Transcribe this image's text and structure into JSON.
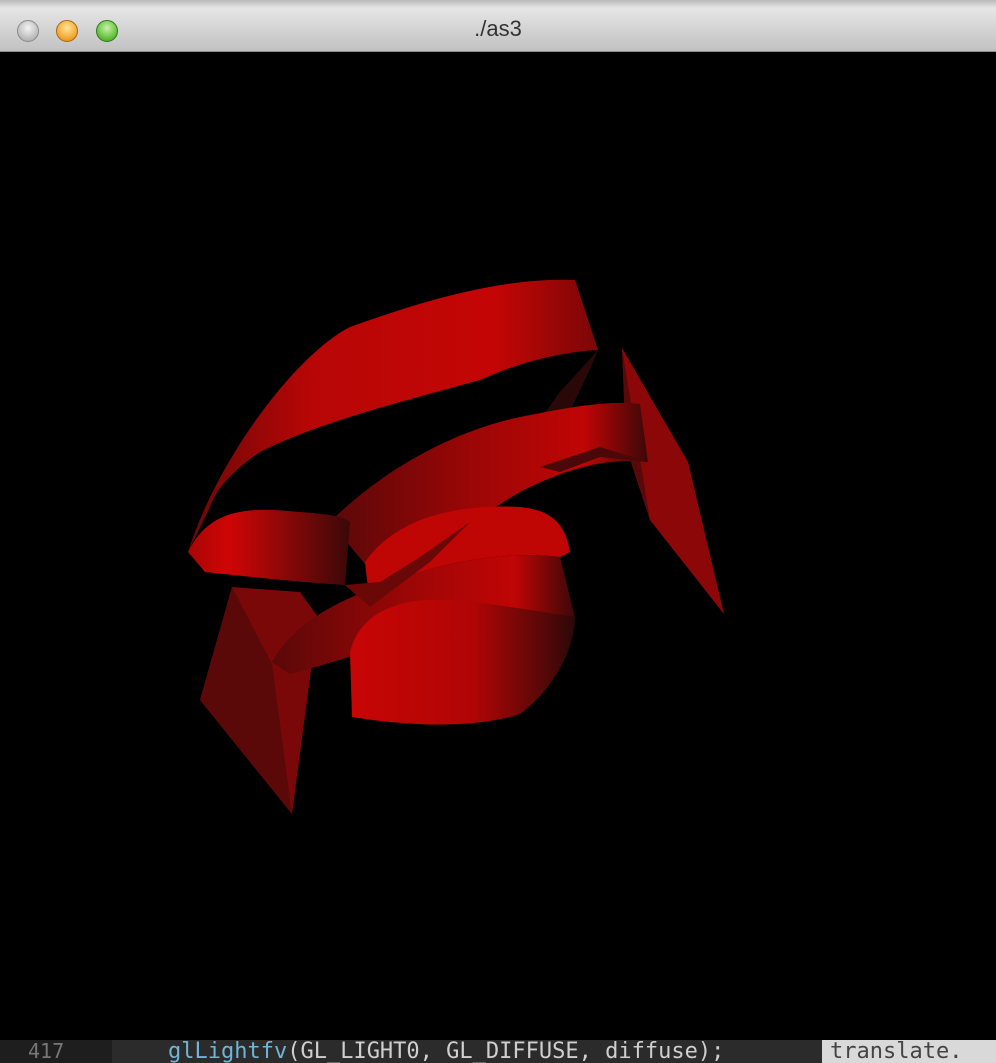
{
  "window": {
    "title": "./as3"
  },
  "background_strip": {
    "line_number": "417",
    "code_function": "glLightfv",
    "code_args": "(GL_LIGHT0, GL_DIFFUSE, diffuse);",
    "side_text": "translate."
  },
  "colors": {
    "ribbon_bright": "#cc0505",
    "ribbon_mid": "#8a0a0a",
    "ribbon_dark": "#3a0808",
    "canvas_background": "#000000"
  }
}
